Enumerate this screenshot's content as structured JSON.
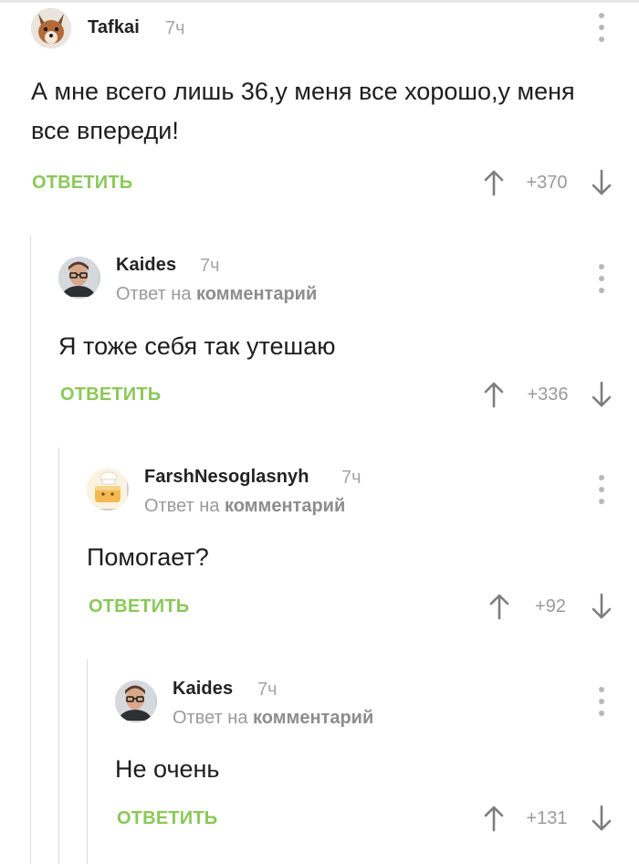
{
  "comments": [
    {
      "author": "Tafkai",
      "time": "7ч",
      "text": "А мне всего лишь 36,у меня все хорошо,у меня все впереди!",
      "reply_label": "ОТВЕТИТЬ",
      "rating": "+370",
      "avatar": "fox-avatar"
    },
    {
      "author": "Kaides",
      "time": "7ч",
      "reply_prefix": "Ответ на",
      "reply_target": "комментарий",
      "text": "Я тоже себя так утешаю",
      "reply_label": "ОТВЕТИТЬ",
      "rating": "+336",
      "avatar": "man-glasses-avatar"
    },
    {
      "author": "FarshNesoglasnyh",
      "time": "7ч",
      "reply_prefix": "Ответ на",
      "reply_target": "комментарий",
      "text": "Помогает?",
      "reply_label": "ОТВЕТИТЬ",
      "rating": "+92",
      "avatar": "chef-cake-avatar"
    },
    {
      "author": "Kaides",
      "time": "7ч",
      "reply_prefix": "Ответ на",
      "reply_target": "комментарий",
      "text": "Не очень",
      "reply_label": "ОТВЕТИТЬ",
      "rating": "+131",
      "avatar": "man-glasses-avatar"
    }
  ],
  "colors": {
    "accent_green": "#8ac858",
    "muted_text": "#9a9a9a",
    "thread_line": "#dcdcdc"
  }
}
